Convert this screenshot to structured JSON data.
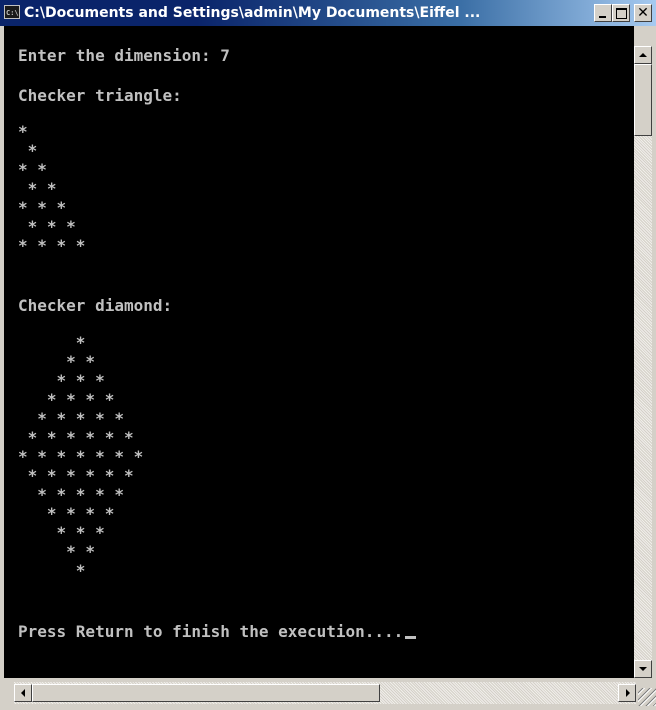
{
  "window": {
    "title": "C:\\Documents and Settings\\admin\\My Documents\\Eiffel ...",
    "icon_name": "console-icon",
    "icon_text": "C:\\"
  },
  "console": {
    "text_color": "#c0c0c0",
    "background": "#000000",
    "lines": [
      "Enter the dimension: 7",
      "Checker triangle:",
      "*",
      " *",
      "* *",
      " * *",
      "* * *",
      " * * *",
      "* * * *",
      "Checker diamond:",
      "      *",
      "     * *",
      "    * * *",
      "   * * * *",
      "  * * * * *",
      " * * * * * *",
      "* * * * * * *",
      " * * * * * *",
      "  * * * * *",
      "   * * * *",
      "    * * *",
      "     * *",
      "      *",
      "Press Return to finish the execution...."
    ]
  }
}
